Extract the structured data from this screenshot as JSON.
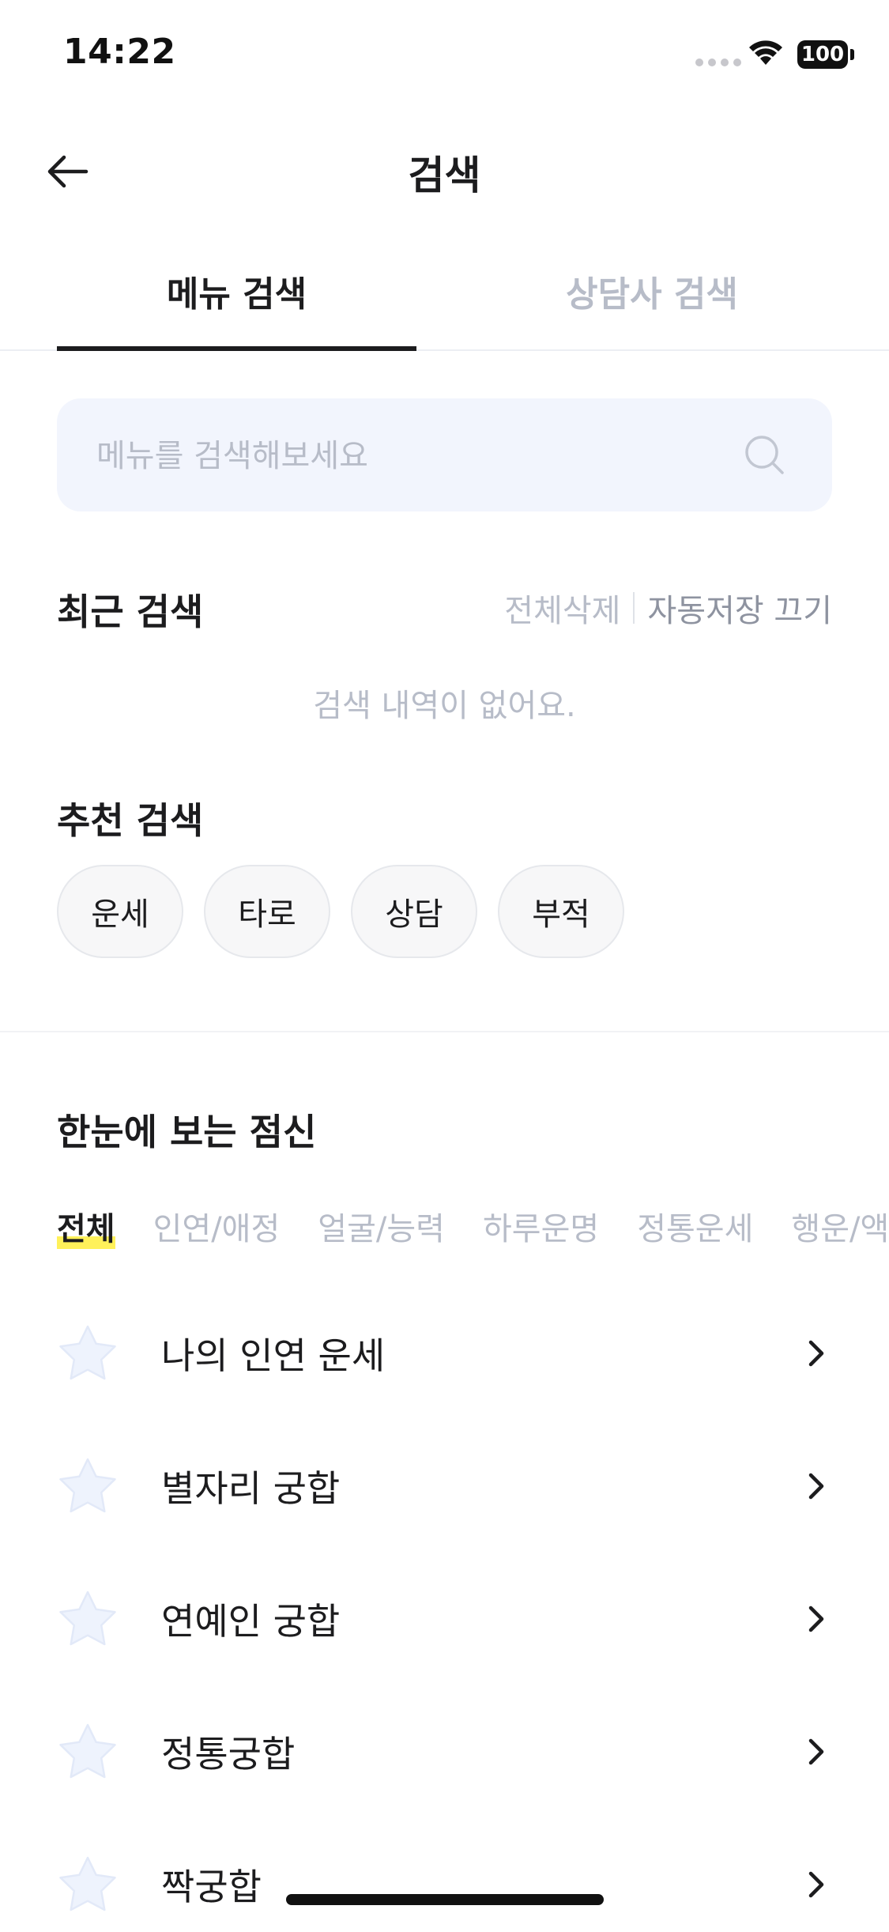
{
  "status_bar": {
    "time": "14:22",
    "battery": "100"
  },
  "header": {
    "title": "검색"
  },
  "tabs": [
    {
      "label": "메뉴 검색",
      "active": true
    },
    {
      "label": "상담사 검색",
      "active": false
    }
  ],
  "search": {
    "placeholder": "메뉴를 검색해보세요",
    "value": ""
  },
  "recent": {
    "title": "최근 검색",
    "delete_all": "전체삭제",
    "autosave_off": "자동저장 끄기",
    "empty_message": "검색 내역이 없어요."
  },
  "recommended": {
    "title": "추천 검색",
    "chips": [
      "운세",
      "타로",
      "상담",
      "부적"
    ]
  },
  "overview": {
    "title": "한눈에 보는 점신",
    "categories": [
      "전체",
      "인연/애정",
      "얼굴/능력",
      "하루운명",
      "정통운세",
      "행운/액운"
    ],
    "active_category": "전체",
    "items": [
      {
        "label": "나의 인연 운세"
      },
      {
        "label": "별자리 궁합"
      },
      {
        "label": "연예인 궁합"
      },
      {
        "label": "정통궁합"
      },
      {
        "label": "짝궁합"
      }
    ]
  },
  "colors": {
    "accent_underline": "#1c1c1e",
    "highlight": "#fff15a",
    "muted_text": "#b7bcc8",
    "search_bg": "#f2f5fd",
    "star_fill": "#eef3fd"
  },
  "icons": {
    "back": "arrow-left-icon",
    "search": "search-icon",
    "favorite": "star-icon",
    "chevron": "chevron-right-icon"
  }
}
